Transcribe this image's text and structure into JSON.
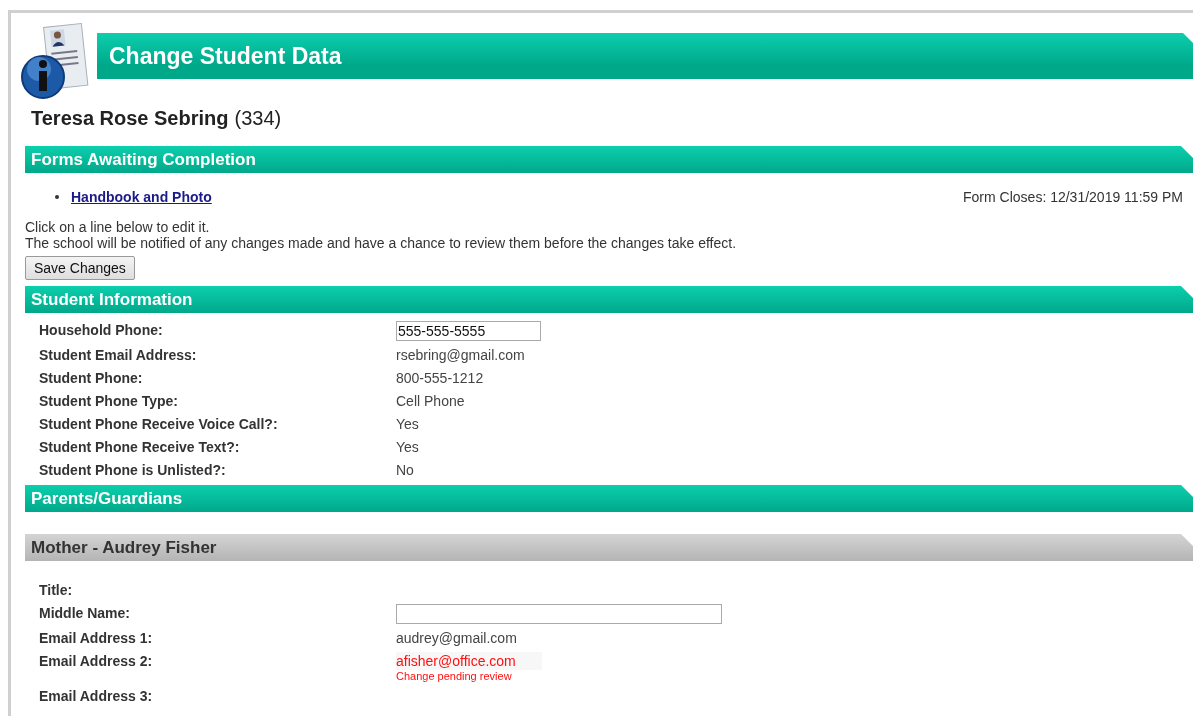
{
  "page_title": "Change Student Data",
  "student": {
    "name": "Teresa Rose Sebring",
    "id": "(334)"
  },
  "forms_section": {
    "title": "Forms Awaiting Completion",
    "forms": [
      {
        "label": "Handbook and Photo",
        "closes": "Form Closes: 12/31/2019 11:59 PM"
      }
    ]
  },
  "instructions": [
    "Click on a line below to edit it.",
    "The school will be notified of any changes made and have a chance to review them before the changes take effect."
  ],
  "save_button": "Save Changes",
  "student_section": {
    "title": "Student Information",
    "fields": [
      {
        "label": "Household Phone:",
        "kind": "input",
        "value": "555-555-5555"
      },
      {
        "label": "Student Email Address:",
        "kind": "text",
        "value": "rsebring@gmail.com"
      },
      {
        "label": "Student Phone:",
        "kind": "text",
        "value": "800-555-1212"
      },
      {
        "label": "Student Phone Type:",
        "kind": "text",
        "value": "Cell Phone"
      },
      {
        "label": "Student Phone Receive Voice Call?:",
        "kind": "text",
        "value": "Yes"
      },
      {
        "label": "Student Phone Receive Text?:",
        "kind": "text",
        "value": "Yes"
      },
      {
        "label": "Student Phone is Unlisted?:",
        "kind": "text",
        "value": "No"
      }
    ]
  },
  "parents_section": {
    "title": "Parents/Guardians",
    "guardians": [
      {
        "title": "Mother - Audrey Fisher",
        "fields": [
          {
            "label": "Title:",
            "kind": "empty"
          },
          {
            "label": "Middle Name:",
            "kind": "input"
          },
          {
            "label": "Email Address 1:",
            "kind": "text",
            "value": "audrey@gmail.com"
          },
          {
            "label": "Email Address 2:",
            "kind": "pending",
            "value": "afisher@office.com",
            "note": "Change pending review"
          },
          {
            "label": "Email Address 3:",
            "kind": "empty"
          }
        ]
      }
    ]
  }
}
